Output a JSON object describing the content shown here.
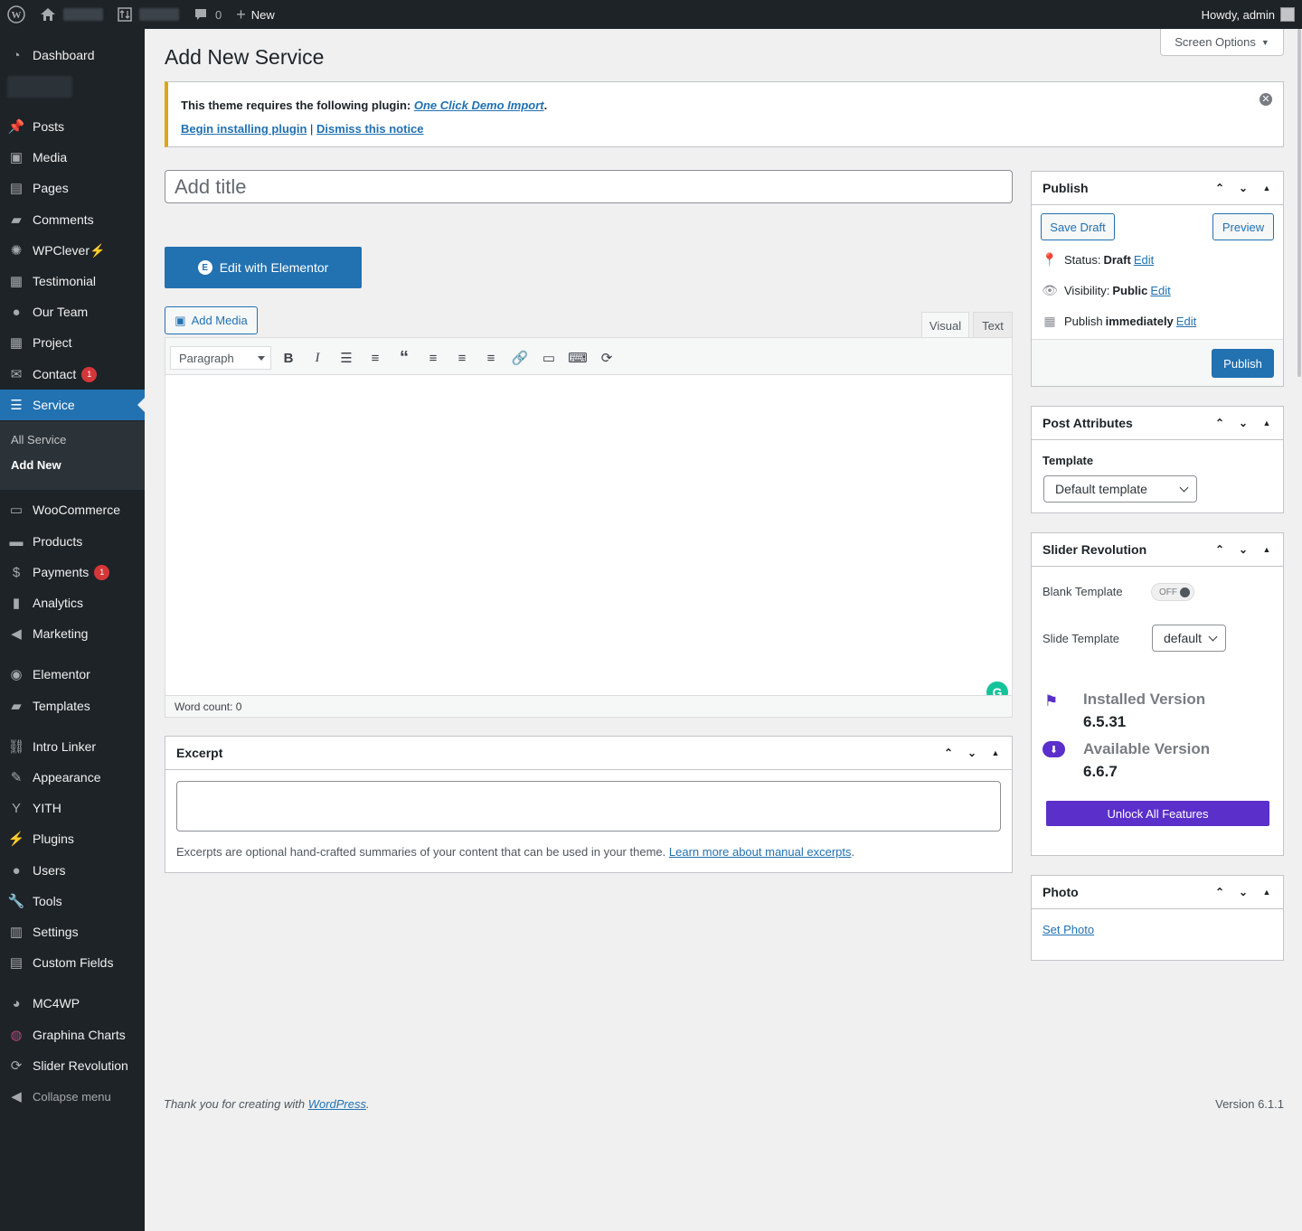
{
  "adminbar": {
    "comments_count": "0",
    "new_label": "New",
    "howdy": "Howdy, admin"
  },
  "sidebar": {
    "items": [
      {
        "label": "Dashboard",
        "icon": "dashboard-icon"
      },
      {
        "label": "Posts",
        "icon": "pin-icon"
      },
      {
        "label": "Media",
        "icon": "media-icon"
      },
      {
        "label": "Pages",
        "icon": "pages-icon"
      },
      {
        "label": "Comments",
        "icon": "comment-icon"
      },
      {
        "label": "WPClever⚡",
        "icon": "bulb-icon"
      },
      {
        "label": "Testimonial",
        "icon": "testimonial-icon"
      },
      {
        "label": "Our Team",
        "icon": "user-icon"
      },
      {
        "label": "Project",
        "icon": "project-icon"
      },
      {
        "label": "Contact",
        "icon": "mail-icon",
        "badge": "1"
      },
      {
        "label": "Service",
        "icon": "service-icon"
      },
      {
        "label": "WooCommerce",
        "icon": "woo-icon"
      },
      {
        "label": "Products",
        "icon": "archive-icon"
      },
      {
        "label": "Payments",
        "icon": "payment-icon",
        "badge": "1"
      },
      {
        "label": "Analytics",
        "icon": "chart-icon"
      },
      {
        "label": "Marketing",
        "icon": "megaphone-icon"
      },
      {
        "label": "Elementor",
        "icon": "elementor-icon"
      },
      {
        "label": "Templates",
        "icon": "folder-icon"
      },
      {
        "label": "Intro Linker",
        "icon": "link-icon"
      },
      {
        "label": "Appearance",
        "icon": "brush-icon"
      },
      {
        "label": "YITH",
        "icon": "yith-icon"
      },
      {
        "label": "Plugins",
        "icon": "plug-icon"
      },
      {
        "label": "Users",
        "icon": "users-icon"
      },
      {
        "label": "Tools",
        "icon": "wrench-icon"
      },
      {
        "label": "Settings",
        "icon": "settings-icon"
      },
      {
        "label": "Custom Fields",
        "icon": "fields-icon"
      },
      {
        "label": "MC4WP",
        "icon": "mc4wp-icon"
      },
      {
        "label": "Graphina Charts",
        "icon": "graphina-icon"
      },
      {
        "label": "Slider Revolution",
        "icon": "refresh-icon"
      }
    ],
    "submenu": {
      "all": "All Service",
      "add_new": "Add New"
    },
    "collapse": "Collapse menu"
  },
  "screen_options": "Screen Options",
  "page_title": "Add New Service",
  "notice": {
    "text": "This theme requires the following plugin:",
    "plugin_link": "One Click Demo Import",
    "period": ".",
    "begin_link": "Begin installing plugin",
    "sep": "|",
    "dismiss_link": "Dismiss this notice"
  },
  "title_placeholder": "Add title",
  "elementor_button": "Edit with Elementor",
  "add_media": "Add Media",
  "editor_tabs": {
    "visual": "Visual",
    "text": "Text"
  },
  "format_select": "Paragraph",
  "word_count": "Word count: 0",
  "excerpt": {
    "title": "Excerpt",
    "help": "Excerpts are optional hand-crafted summaries of your content that can be used in your theme.",
    "help_link": "Learn more about manual excerpts",
    "period": "."
  },
  "publish": {
    "title": "Publish",
    "save_draft": "Save Draft",
    "preview": "Preview",
    "status_label": "Status:",
    "status_value": "Draft",
    "visibility_label": "Visibility:",
    "visibility_value": "Public",
    "publish_label": "Publish",
    "publish_value": "immediately",
    "edit": "Edit",
    "publish_button": "Publish"
  },
  "post_attributes": {
    "title": "Post Attributes",
    "template_label": "Template",
    "template_value": "Default template"
  },
  "slider_revolution": {
    "title": "Slider Revolution",
    "blank_template": "Blank Template",
    "toggle_state": "OFF",
    "slide_template": "Slide Template",
    "slide_template_value": "default",
    "installed_label": "Installed Version",
    "installed_value": "6.5.31",
    "available_label": "Available Version",
    "available_value": "6.6.7",
    "unlock": "Unlock All Features",
    "unlock_color": "#5b2fc9"
  },
  "photo": {
    "title": "Photo",
    "set_photo": "Set Photo"
  },
  "footer": {
    "thanks": "Thank you for creating with",
    "wp_link": "WordPress",
    "period": ".",
    "version": "Version 6.1.1"
  }
}
